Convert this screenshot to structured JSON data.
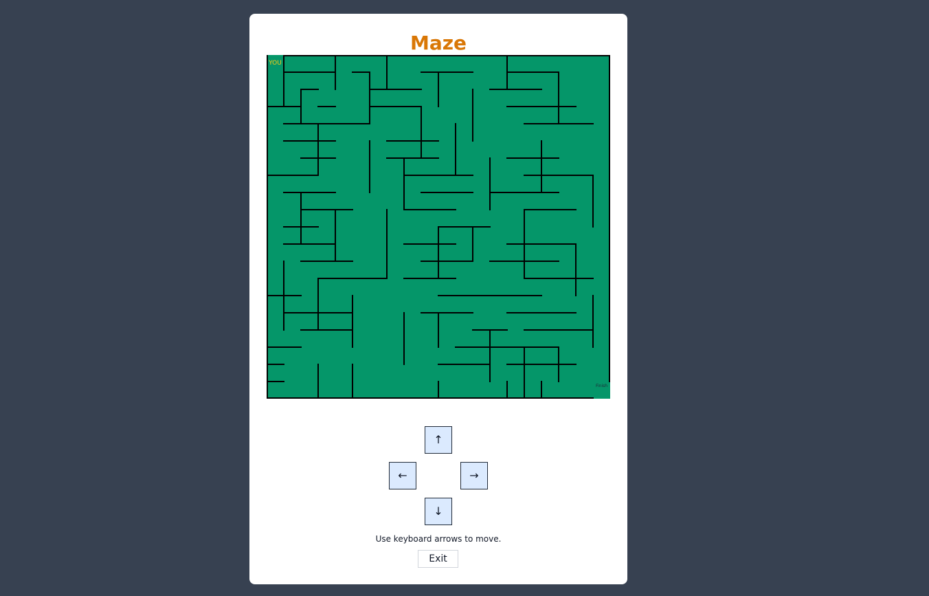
{
  "game": {
    "title": "Maze",
    "player_label": "YOU",
    "finish_label": "Finish",
    "instructions": "Use keyboard arrows to move.",
    "exit_label": "Exit"
  },
  "controls": {
    "up": "↑",
    "left": "←",
    "right": "→",
    "down": "↓"
  },
  "maze": {
    "rows": 20,
    "cols": 20,
    "player_cell": [
      0,
      0
    ],
    "finish_cell": [
      19,
      19
    ],
    "floor_color": "#059669",
    "wall_color": "#000000",
    "player_color": "#facc15",
    "title_color": "#d97706",
    "horizontal_walls": [
      [
        1,
        1,
        1,
        4
      ],
      [
        2,
        2,
        2,
        3
      ],
      [
        3,
        0,
        3,
        2
      ],
      [
        3,
        3,
        3,
        4
      ],
      [
        4,
        1,
        4,
        6
      ],
      [
        5,
        1,
        5,
        4
      ],
      [
        6,
        2,
        6,
        4
      ],
      [
        7,
        0,
        7,
        3
      ],
      [
        8,
        1,
        8,
        4
      ],
      [
        9,
        2,
        9,
        5
      ],
      [
        10,
        1,
        10,
        3
      ],
      [
        11,
        1,
        11,
        4
      ],
      [
        12,
        2,
        12,
        5
      ],
      [
        13,
        3,
        13,
        7
      ],
      [
        14,
        0,
        14,
        2
      ],
      [
        15,
        1,
        15,
        5
      ],
      [
        16,
        2,
        16,
        5
      ],
      [
        17,
        0,
        17,
        2
      ],
      [
        18,
        0,
        18,
        1
      ],
      [
        19,
        0,
        19,
        1
      ],
      [
        1,
        5,
        1,
        6
      ],
      [
        1,
        9,
        1,
        12
      ],
      [
        2,
        6,
        2,
        9
      ],
      [
        3,
        6,
        3,
        9
      ],
      [
        5,
        7,
        5,
        10
      ],
      [
        6,
        7,
        6,
        10
      ],
      [
        7,
        8,
        7,
        12
      ],
      [
        8,
        9,
        8,
        12
      ],
      [
        9,
        8,
        9,
        11
      ],
      [
        10,
        10,
        10,
        13
      ],
      [
        11,
        8,
        11,
        11
      ],
      [
        12,
        9,
        12,
        12
      ],
      [
        13,
        8,
        13,
        11
      ],
      [
        14,
        10,
        14,
        13
      ],
      [
        15,
        9,
        15,
        12
      ],
      [
        16,
        12,
        16,
        14
      ],
      [
        17,
        11,
        17,
        15
      ],
      [
        18,
        10,
        18,
        13
      ],
      [
        1,
        14,
        1,
        17
      ],
      [
        2,
        13,
        2,
        16
      ],
      [
        3,
        14,
        3,
        18
      ],
      [
        4,
        15,
        4,
        19
      ],
      [
        6,
        14,
        6,
        17
      ],
      [
        7,
        15,
        7,
        19
      ],
      [
        8,
        13,
        8,
        17
      ],
      [
        9,
        15,
        9,
        18
      ],
      [
        11,
        14,
        11,
        18
      ],
      [
        12,
        13,
        12,
        17
      ],
      [
        13,
        15,
        13,
        19
      ],
      [
        14,
        12,
        14,
        16
      ],
      [
        15,
        14,
        15,
        18
      ],
      [
        16,
        15,
        16,
        19
      ],
      [
        17,
        13,
        17,
        17
      ],
      [
        18,
        14,
        18,
        18
      ]
    ],
    "vertical_walls": [
      [
        0,
        1,
        3,
        1
      ],
      [
        2,
        2,
        4,
        2
      ],
      [
        0,
        4,
        2,
        4
      ],
      [
        1,
        6,
        4,
        6
      ],
      [
        3,
        9,
        6,
        9
      ],
      [
        0,
        7,
        2,
        7
      ],
      [
        1,
        10,
        3,
        10
      ],
      [
        2,
        12,
        5,
        12
      ],
      [
        0,
        14,
        2,
        14
      ],
      [
        1,
        17,
        4,
        17
      ],
      [
        4,
        3,
        7,
        3
      ],
      [
        5,
        6,
        8,
        6
      ],
      [
        6,
        8,
        9,
        8
      ],
      [
        4,
        11,
        7,
        11
      ],
      [
        6,
        13,
        9,
        13
      ],
      [
        5,
        16,
        8,
        16
      ],
      [
        7,
        19,
        10,
        19
      ],
      [
        8,
        2,
        11,
        2
      ],
      [
        9,
        4,
        12,
        4
      ],
      [
        9,
        7,
        13,
        7
      ],
      [
        10,
        10,
        13,
        10
      ],
      [
        10,
        12,
        12,
        12
      ],
      [
        9,
        15,
        13,
        15
      ],
      [
        11,
        18,
        14,
        18
      ],
      [
        12,
        1,
        16,
        1
      ],
      [
        13,
        3,
        16,
        3
      ],
      [
        14,
        5,
        17,
        5
      ],
      [
        15,
        8,
        18,
        8
      ],
      [
        15,
        10,
        17,
        10
      ],
      [
        16,
        13,
        19,
        13
      ],
      [
        17,
        15,
        20,
        15
      ],
      [
        17,
        17,
        19,
        17
      ],
      [
        18,
        3,
        20,
        3
      ],
      [
        18,
        5,
        20,
        5
      ],
      [
        19,
        10,
        20,
        10
      ],
      [
        19,
        14,
        20,
        14
      ],
      [
        19,
        16,
        20,
        16
      ],
      [
        14,
        19,
        17,
        19
      ]
    ]
  }
}
